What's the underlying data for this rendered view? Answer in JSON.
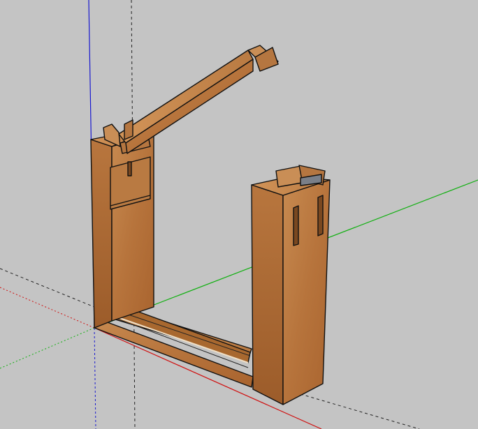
{
  "app": {
    "kind": "3d-modeling-viewport",
    "background": "#c4c4c4"
  },
  "axes": {
    "red": "#d01010",
    "green": "#10b010",
    "blue": "#1010d0",
    "dashed": "#222222"
  },
  "model": {
    "wood_light": "#c8884e",
    "wood_mid": "#b06d38",
    "wood_dark": "#8a5226",
    "edge": "#111111"
  }
}
